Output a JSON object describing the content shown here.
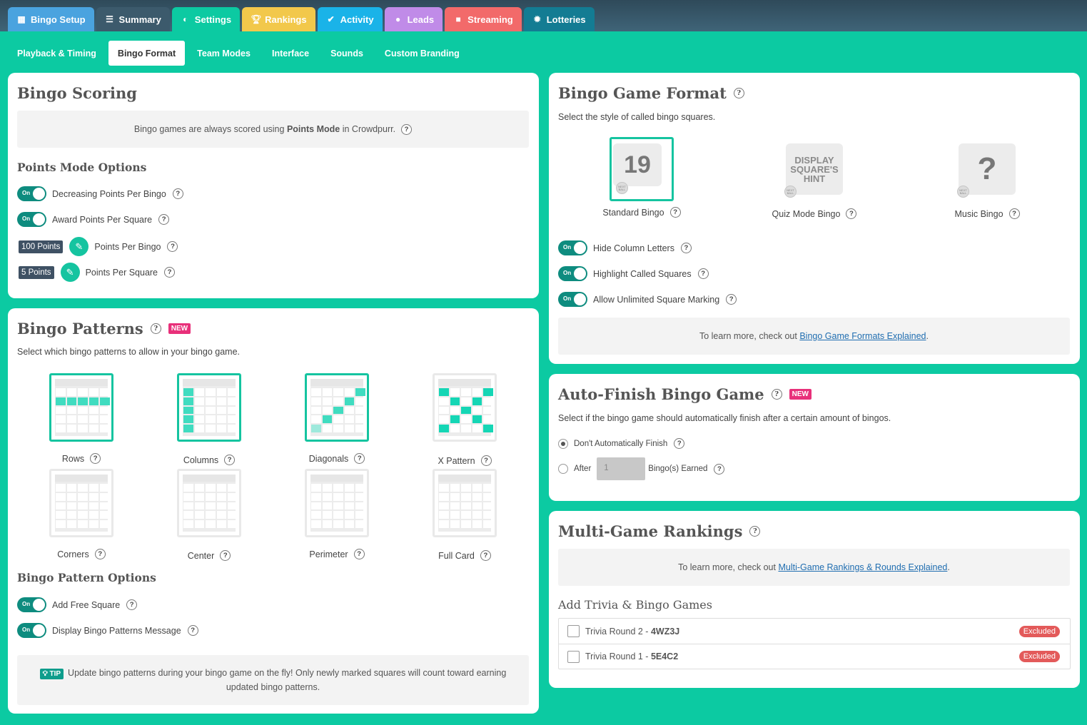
{
  "main_tabs": [
    {
      "label": "Bingo Setup",
      "icon": "grid-icon",
      "color": "#4aa3df"
    },
    {
      "label": "Summary",
      "icon": "list-icon",
      "color": "#3c5a6c"
    },
    {
      "label": "Settings",
      "icon": "toggle-icon",
      "color": "#0ccaa2"
    },
    {
      "label": "Rankings",
      "icon": "trophy-icon",
      "color": "#f2c84b"
    },
    {
      "label": "Activity",
      "icon": "check-circle-icon",
      "color": "#1ab3e8"
    },
    {
      "label": "Leads",
      "icon": "user-icon",
      "color": "#c08be8"
    },
    {
      "label": "Streaming",
      "icon": "video-icon",
      "color": "#f26a6a"
    },
    {
      "label": "Lotteries",
      "icon": "gear-icon",
      "color": "#137c93"
    }
  ],
  "sub_tabs": [
    "Playback & Timing",
    "Bingo Format",
    "Team Modes",
    "Interface",
    "Sounds",
    "Custom Branding"
  ],
  "scoring": {
    "title": "Bingo Scoring",
    "info_pre": "Bingo games are always scored using ",
    "info_bold": "Points Mode",
    "info_post": " in Crowdpurr.",
    "options_title": "Points Mode Options",
    "toggle_on": "On",
    "decreasing": "Decreasing Points Per Bingo",
    "award": "Award Points Per Square",
    "per_bingo_value": "100 Points",
    "per_bingo_label": "Points Per Bingo",
    "per_square_value": "5 Points",
    "per_square_label": "Points Per Square"
  },
  "patterns": {
    "title": "Bingo Patterns",
    "new_badge": "NEW",
    "subtitle": "Select which bingo patterns to allow in your bingo game.",
    "items": [
      {
        "label": "Rows",
        "selected": true
      },
      {
        "label": "Columns",
        "selected": true
      },
      {
        "label": "Diagonals",
        "selected": true
      },
      {
        "label": "X Pattern",
        "selected": false
      },
      {
        "label": "Corners",
        "selected": false
      },
      {
        "label": "Center",
        "selected": false
      },
      {
        "label": "Perimeter",
        "selected": false
      },
      {
        "label": "Full Card",
        "selected": false
      }
    ],
    "options_title": "Bingo Pattern Options",
    "free_square": "Add Free Square",
    "display_msg": "Display Bingo Patterns Message",
    "tip_badge": "TIP",
    "tip_text": "Update bingo patterns during your bingo game on the fly! Only newly marked squares will count toward earning updated bingo patterns."
  },
  "format": {
    "title": "Bingo Game Format",
    "subtitle": "Select the style of called bingo squares.",
    "standard_label": "Standard Bingo",
    "standard_number": "19",
    "quiz_label": "Quiz Mode Bingo",
    "quiz_text": "DISPLAY SQUARE'S HINT",
    "music_label": "Music Bingo",
    "music_glyph": "?",
    "next_ball": "NEXT BALL",
    "hide_letters": "Hide Column Letters",
    "highlight": "Highlight Called Squares",
    "unlimited": "Allow Unlimited Square Marking",
    "learn_pre": "To learn more, check out ",
    "learn_link": "Bingo Game Formats Explained",
    "learn_post": "."
  },
  "autofinish": {
    "title": "Auto-Finish Bingo Game",
    "new_badge": "NEW",
    "subtitle": "Select if the bingo game should automatically finish after a certain amount of bingos.",
    "opt1": "Don't Automatically Finish",
    "opt2_pre": "After",
    "opt2_value": "1",
    "opt2_post": "Bingo(s) Earned"
  },
  "rankings": {
    "title": "Multi-Game Rankings",
    "learn_pre": "To learn more, check out ",
    "learn_link": "Multi-Game Rankings & Rounds Explained",
    "learn_post": ".",
    "add_title": "Add Trivia & Bingo Games",
    "games": [
      {
        "name": "Trivia Round 2 - ",
        "code": "4WZ3J",
        "status": "Excluded"
      },
      {
        "name": "Trivia Round 1 - ",
        "code": "5E4C2",
        "status": "Excluded"
      }
    ]
  }
}
